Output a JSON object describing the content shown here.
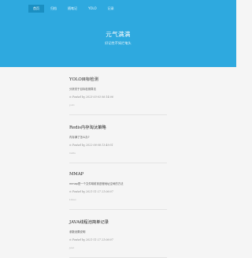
{
  "nav": {
    "items": [
      "首页",
      "归档",
      "随笔记",
      "YOLO",
      "记录"
    ],
    "active_index": 0
  },
  "header": {
    "title": "元气满满",
    "subtitle": "好记性不如烂笔头"
  },
  "posts": [
    {
      "title": "YOLO目标检测",
      "excerpt": "分析关于目标检测算法",
      "meta": "Posted by 2023-03-03 06:14:06",
      "tag": "yolo"
    },
    {
      "title": "Redis内存淘汰策略",
      "excerpt": "内存满了怎么办?",
      "meta": "Posted by 2022-06-08 13:49:51",
      "tag": "redis"
    },
    {
      "title": "MMAP",
      "excerpt": "mmap是一个文件映射到进程地址空间的方法",
      "meta": "Posted by 2021-11-27 21:06:07",
      "tag": "Linux"
    },
    {
      "title": "JAVA线程池简单记录",
      "excerpt": "参数设置说明",
      "meta": "Posted by 2021-11-27 21:06:07",
      "tag": "java"
    }
  ]
}
